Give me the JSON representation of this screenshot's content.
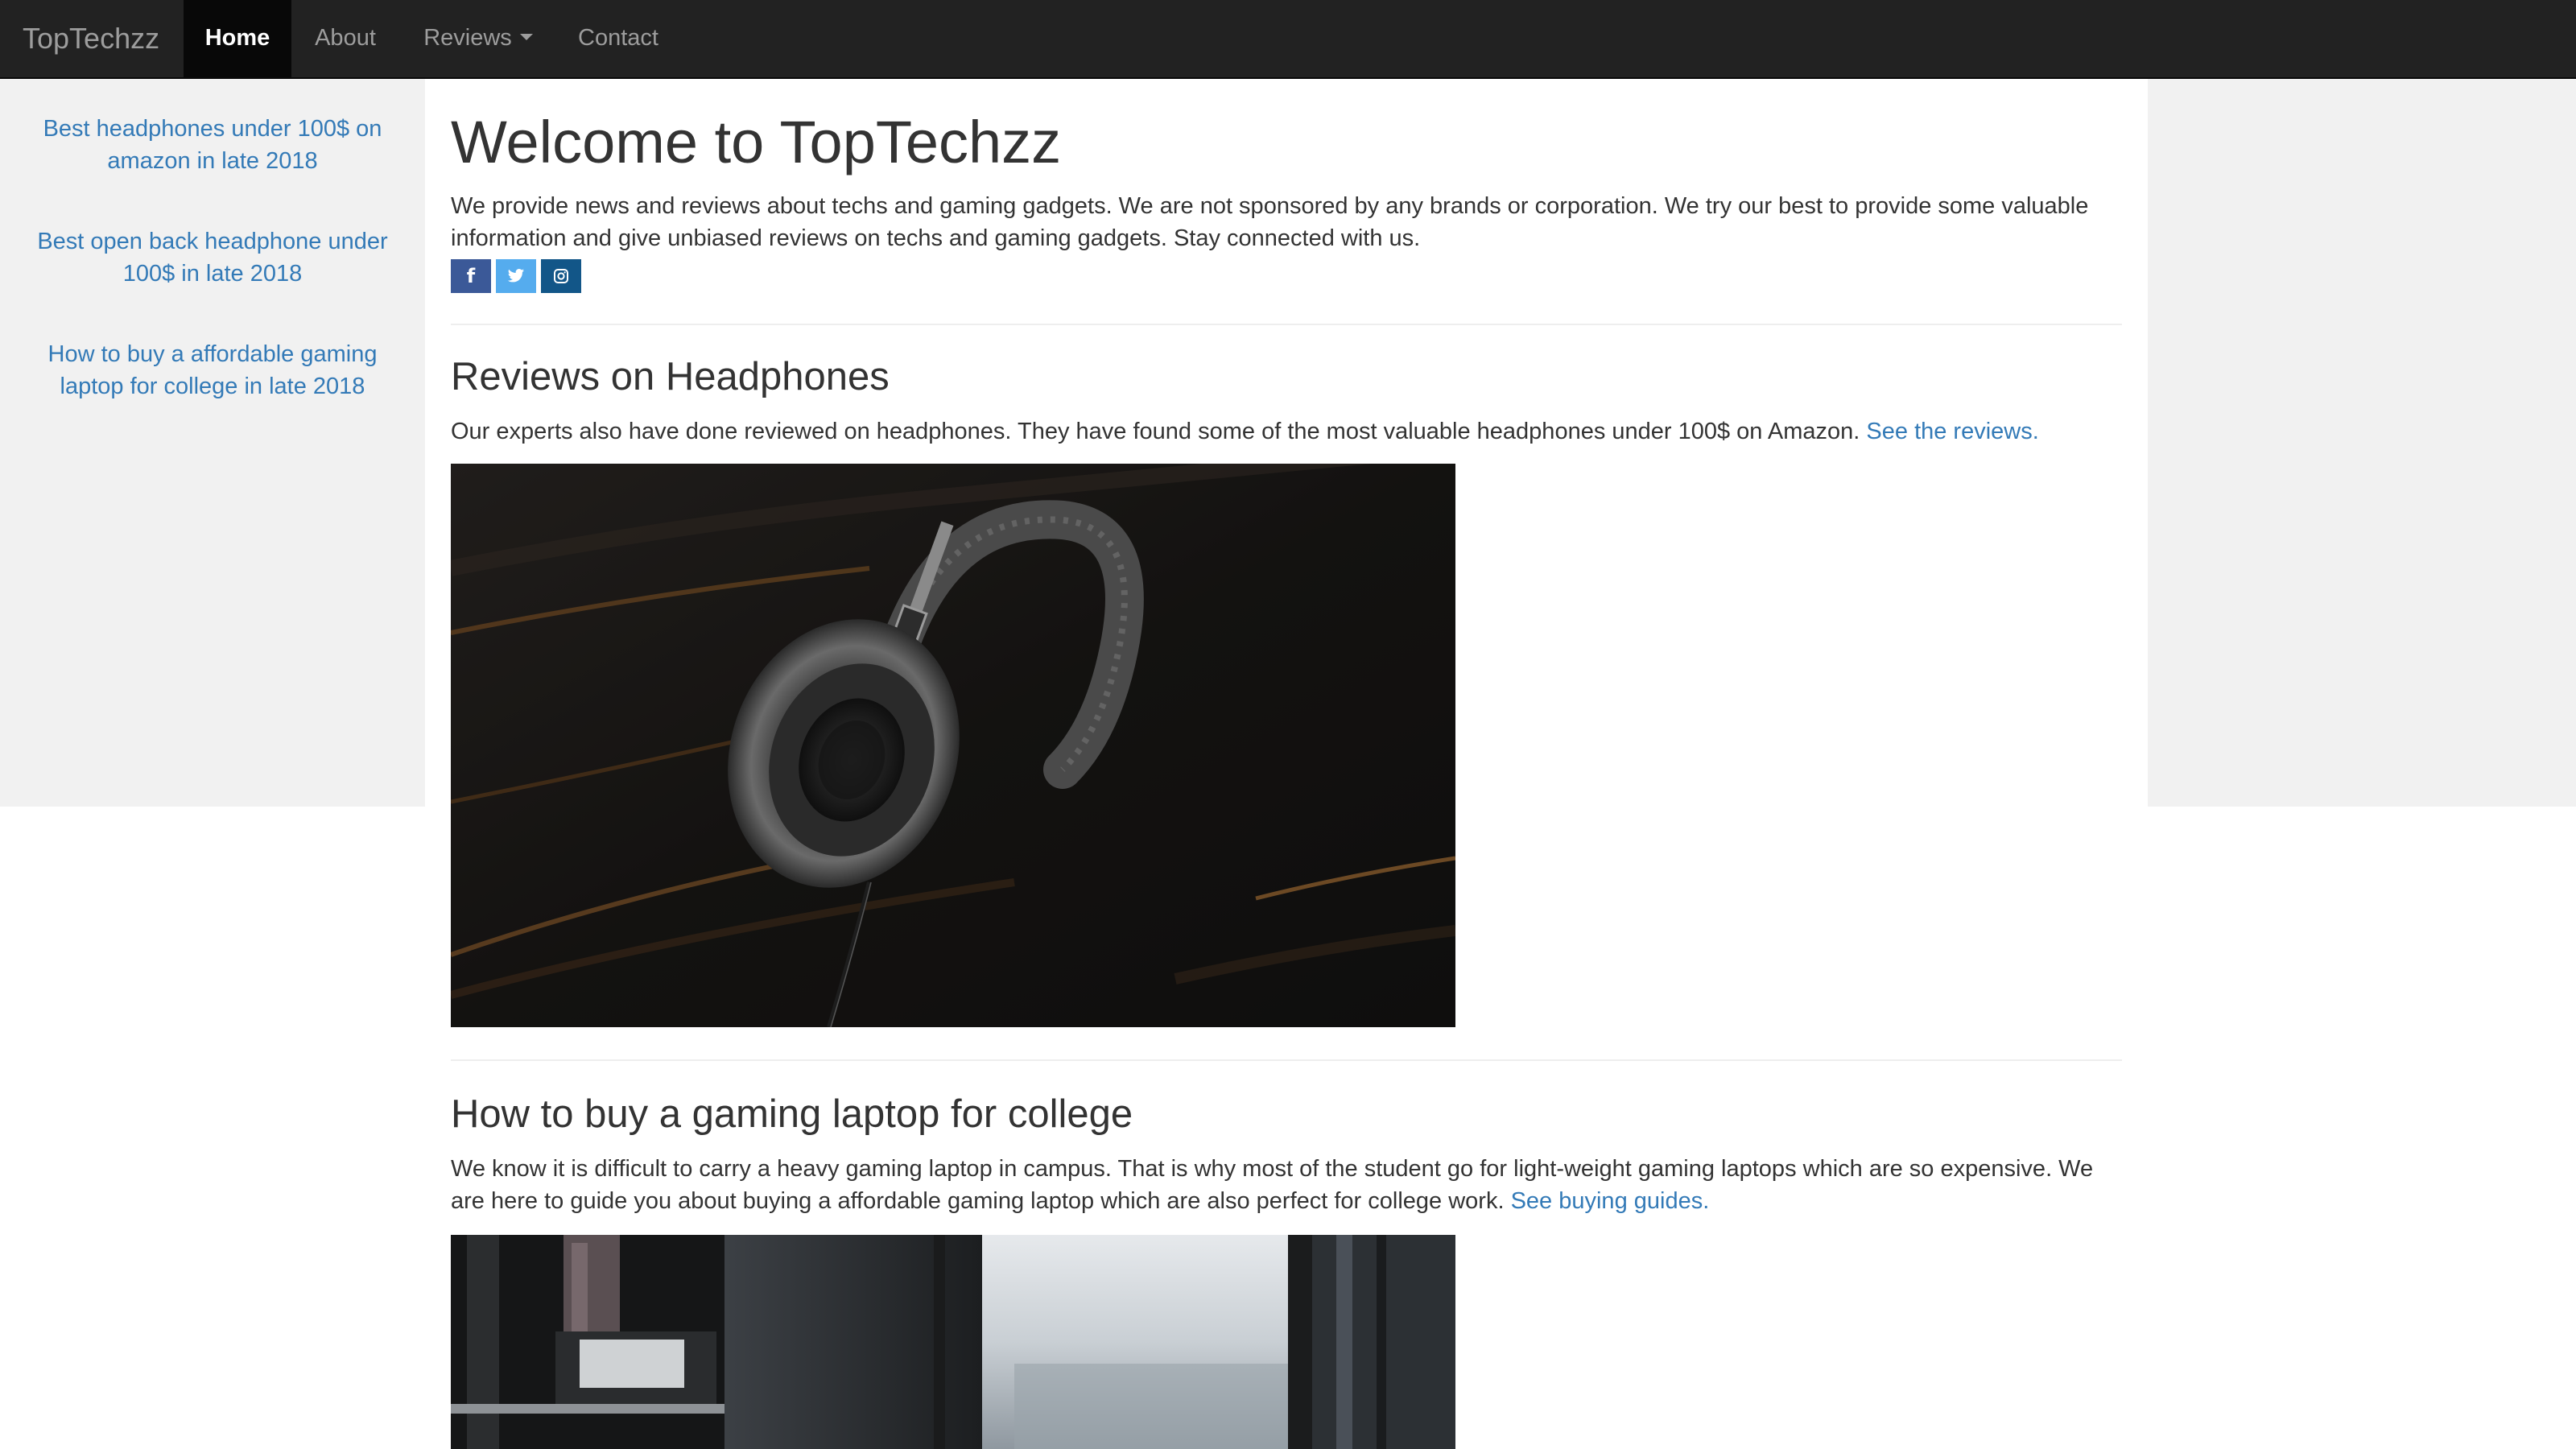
{
  "navbar": {
    "brand": "TopTechzz",
    "items": [
      {
        "label": "Home",
        "active": true
      },
      {
        "label": "About",
        "active": false
      },
      {
        "label": "Reviews",
        "active": false,
        "dropdown": true
      },
      {
        "label": "Contact",
        "active": false
      }
    ]
  },
  "sidebar": {
    "links": [
      {
        "label": "Best headphones under 100$ on amazon in late 2018"
      },
      {
        "label": "Best open back headphone under 100$ in late 2018"
      },
      {
        "label": "How to buy a affordable gaming laptop for college in late 2018"
      }
    ]
  },
  "main": {
    "title": "Welcome to TopTechzz",
    "intro": "We provide news and reviews about techs and gaming gadgets. We are not sponsored by any brands or corporation. We try our best to provide some valuable information and give unbiased reviews on techs and gaming gadgets. Stay connected with us.",
    "social": [
      {
        "icon": "facebook-icon",
        "glyph": "f",
        "color": "#3b5998"
      },
      {
        "icon": "twitter-icon",
        "glyph": "t",
        "color": "#55acee"
      },
      {
        "icon": "instagram-icon",
        "glyph": "◎",
        "color": "#125688"
      }
    ],
    "sections": [
      {
        "title": "Reviews on Headphones",
        "text": "Our experts also have done reviewed on headphones. They have found some of the most valuable headphones under 100$ on Amazon.",
        "link": "See the reviews.",
        "image": "headphones-photo"
      },
      {
        "title": "How to buy a gaming laptop for college",
        "text": "We know it is difficult to carry a heavy gaming laptop in campus. That is why most of the student go for light-weight gaming laptops which are so expensive. We are here to guide you about buying a affordable gaming laptop which are also perfect for college work.",
        "link": "See buying guides.",
        "image": "laptop-desk-photo"
      }
    ]
  },
  "colors": {
    "navbar_bg": "#222222",
    "link": "#337ab7",
    "sidebar_bg": "#f1f1f1"
  }
}
